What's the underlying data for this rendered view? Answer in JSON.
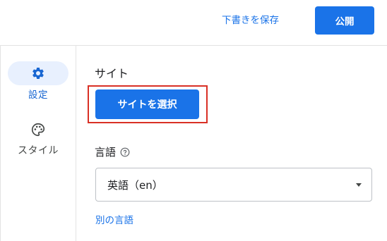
{
  "header": {
    "save_draft_label": "下書きを保存",
    "publish_label": "公開"
  },
  "sidebar": {
    "items": [
      {
        "label": "設定",
        "icon": "gear-icon",
        "active": true
      },
      {
        "label": "スタイル",
        "icon": "palette-icon",
        "active": false
      }
    ]
  },
  "main": {
    "site_label": "サイト",
    "select_site_button": "サイトを選択",
    "language_label": "言語",
    "language_help_icon": "help-circle-icon",
    "language_value": "英語（en）",
    "other_language_link": "別の言語"
  },
  "colors": {
    "accent": "#1a73e8",
    "active_nav_bg": "#e8f0fe",
    "highlight_border": "#d93025"
  }
}
